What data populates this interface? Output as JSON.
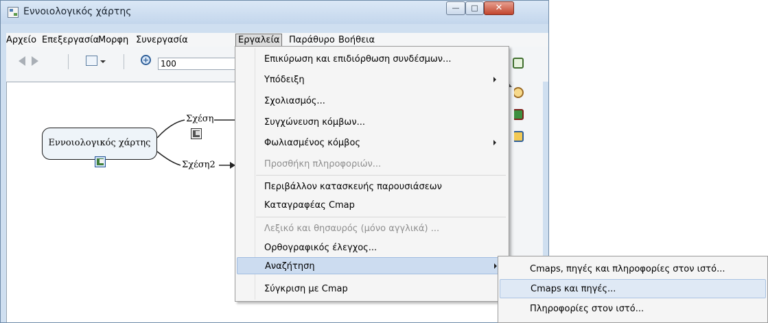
{
  "window": {
    "title": "Εννοιολογικός χάρτης",
    "minimize_glyph": "—",
    "maximize_glyph": "□",
    "close_glyph": "✕"
  },
  "menubar": [
    {
      "label": "Αρχείο"
    },
    {
      "label": "Επεξεργασία"
    },
    {
      "label": "Μορφη"
    },
    {
      "label": "Συνεργασία"
    },
    {
      "label": "Εργαλεία",
      "active": true
    },
    {
      "label": "Παράθυρο"
    },
    {
      "label": "Βοήθεια"
    }
  ],
  "toolbar": {
    "zoom_value": "100",
    "zoom_icon": "zoom-in-icon",
    "view_icon": "view-mode-icon"
  },
  "right_panel": {
    "icons": [
      "concept-tool-icon",
      "brush-format-icon",
      "notes-book-icon",
      "presentation-icon"
    ]
  },
  "map": {
    "concept": "Εννοιολογικός χάρτης",
    "links": [
      {
        "label": "Σχέση"
      },
      {
        "label": "Σχέση2"
      }
    ]
  },
  "tools_menu": {
    "items": [
      {
        "label": "Επικύρωση και επιδιόρθωση συνδέσμων...",
        "disabled": false,
        "submenu": false
      },
      {
        "label": "Υπόδειξη",
        "disabled": false,
        "submenu": true
      },
      {
        "label": "Σχολιασμός...",
        "disabled": false,
        "submenu": false
      },
      {
        "label": "Συγχώνευση κόμβων...",
        "disabled": false,
        "submenu": false
      },
      {
        "label": "Φωλιασμένος κόμβος",
        "disabled": false,
        "submenu": true
      },
      {
        "label": "Προσθήκη πληροφοριών...",
        "disabled": true,
        "submenu": false
      },
      {
        "label": "Περιβάλλον κατασκευής παρουσιάσεων",
        "disabled": false,
        "submenu": false
      },
      {
        "label": "Καταγραφέας Cmap",
        "disabled": false,
        "submenu": false
      },
      {
        "label": "Λεξικό και θησαυρός (μόνο αγγλικά) ...",
        "disabled": true,
        "submenu": false
      },
      {
        "label": "Ορθογραφικός έλεγχος...",
        "disabled": false,
        "submenu": false
      },
      {
        "label": "Αναζήτηση",
        "disabled": false,
        "submenu": true,
        "selected": true
      },
      {
        "label": "Σύγκριση με Cmap",
        "disabled": false,
        "submenu": false
      }
    ]
  },
  "search_submenu": {
    "items": [
      {
        "label": "Cmaps, πηγές και πληροφορίες στον ιστό..."
      },
      {
        "label": "Cmaps και πηγές...",
        "selected": true
      },
      {
        "label": "Πληροφορίες στον ιστό..."
      }
    ]
  }
}
